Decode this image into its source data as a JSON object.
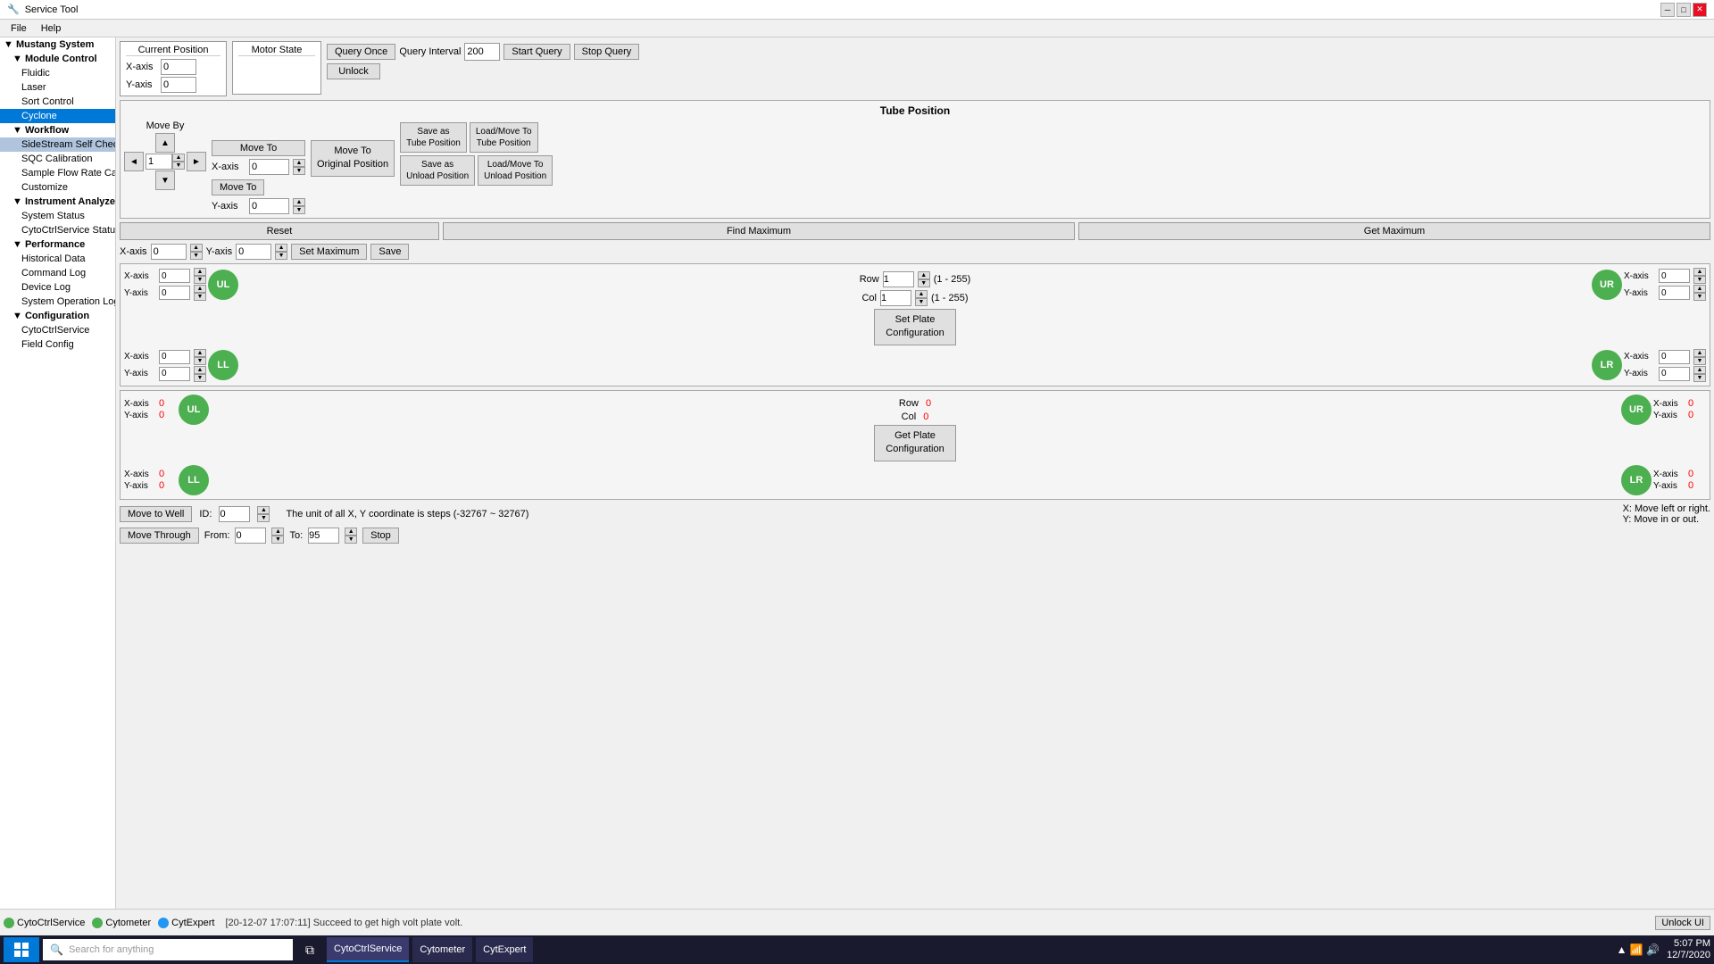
{
  "window": {
    "title": "Service Tool",
    "min_btn": "─",
    "max_btn": "□",
    "close_btn": "✕"
  },
  "menu": {
    "items": [
      "File",
      "Help"
    ]
  },
  "sidebar": {
    "items": [
      {
        "id": "mustang-system",
        "label": "Mustang System",
        "level": 0,
        "arrow": "▼"
      },
      {
        "id": "module-control",
        "label": "Module Control",
        "level": 1,
        "arrow": "▼"
      },
      {
        "id": "fluidic",
        "label": "Fluidic",
        "level": 2
      },
      {
        "id": "laser",
        "label": "Laser",
        "level": 2
      },
      {
        "id": "sort-control",
        "label": "Sort Control",
        "level": 2
      },
      {
        "id": "cyclone",
        "label": "Cyclone",
        "level": 2,
        "selected": true
      },
      {
        "id": "workflow",
        "label": "Workflow",
        "level": 1,
        "arrow": "▼"
      },
      {
        "id": "sidestream-self-check",
        "label": "SideStream Self Check",
        "level": 2,
        "highlighted": true
      },
      {
        "id": "sqc-calibration",
        "label": "SQC Calibration",
        "level": 2
      },
      {
        "id": "sample-flow-rate",
        "label": "Sample Flow Rate Calibration",
        "level": 2
      },
      {
        "id": "customize",
        "label": "Customize",
        "level": 2
      },
      {
        "id": "instrument-analyze",
        "label": "Instrument Analyze",
        "level": 1,
        "arrow": "▼"
      },
      {
        "id": "system-status",
        "label": "System Status",
        "level": 2
      },
      {
        "id": "cytoctrl-service-status",
        "label": "CytoCtrlService Status",
        "level": 2
      },
      {
        "id": "performance",
        "label": "Performance",
        "level": 1,
        "arrow": "▼"
      },
      {
        "id": "historical-data",
        "label": "Historical Data",
        "level": 2
      },
      {
        "id": "command-log",
        "label": "Command Log",
        "level": 2
      },
      {
        "id": "device-log",
        "label": "Device Log",
        "level": 2
      },
      {
        "id": "system-operation-log",
        "label": "System Operation Log",
        "level": 2
      },
      {
        "id": "configuration",
        "label": "Configuration",
        "level": 1,
        "arrow": "▼"
      },
      {
        "id": "cytoctrlservice",
        "label": "CytoCtrlService",
        "level": 2
      },
      {
        "id": "field-config",
        "label": "Field Config",
        "level": 2
      }
    ]
  },
  "content": {
    "query_once_label": "Query Once",
    "query_interval_label": "Query Interval",
    "query_interval_value": "200",
    "start_query_label": "Start Query",
    "stop_query_label": "Stop Query",
    "unlock_label": "Unlock",
    "current_position_title": "Current Position",
    "motor_state_title": "Motor State",
    "xaxis_label": "X-axis",
    "yaxis_label": "Y-axis",
    "xaxis_value": "0",
    "yaxis_value": "0",
    "move_by_label": "Move By",
    "move_to_label": "Move To",
    "move_to2_label": "Move To",
    "move_to_original_label": "Move To\nOriginal Position",
    "moveto_x_value": "0",
    "moveto_y_value": "0",
    "nav_value": "1",
    "save_tube_position_label": "Save as\nTube Position",
    "load_move_tube_label": "Load/Move To\nTube Position",
    "save_unload_label": "Save as\nUnload Position",
    "load_move_unload_label": "Load/Move To\nUnload Position",
    "reset_label": "Reset",
    "find_maximum_label": "Find Maximum",
    "get_maximum_label": "Get Maximum",
    "set_maximum_label": "Set Maximum",
    "save_label": "Save",
    "max_xaxis_label": "X-axis",
    "max_yaxis_label": "Y-axis",
    "max_xaxis_value": "0",
    "max_yaxis_value": "0",
    "ul_label": "UL",
    "ur_label": "UR",
    "ll_label": "LL",
    "lr_label": "LR",
    "ul1_x": "0",
    "ul1_y": "0",
    "ur1_x": "0",
    "ur1_y": "0",
    "ll1_x": "0",
    "ll1_y": "0",
    "lr1_x": "0",
    "lr1_y": "0",
    "row_label": "Row",
    "col_label": "Col",
    "row_value": "1",
    "col_value": "1",
    "row_range": "(1 - 255)",
    "col_range": "(1 - 255)",
    "set_plate_config_label": "Set Plate\nConfiguration",
    "ul2_label": "UL",
    "ur2_label": "UR",
    "ll2_label": "LL",
    "lr2_label": "LR",
    "ul2_x": "0",
    "ul2_y": "0",
    "ur2_x": "0",
    "ur2_y": "0",
    "ll2_x": "0",
    "ll2_y": "0",
    "lr2_x": "0",
    "lr2_y": "0",
    "row2_label": "Row",
    "col2_label": "Col",
    "row2_value": "0",
    "col2_value": "0",
    "get_plate_config_label": "Get Plate\nConfiguration",
    "move_to_well_label": "Move to Well",
    "id_label": "ID:",
    "id_value": "0",
    "unit_info": "The unit of all X, Y coordinate is steps (-32767 ~ 32767)",
    "move_info_x": "X: Move left or right.",
    "move_info_y": "Y: Move in or out.",
    "move_through_label": "Move Through",
    "from_label": "From:",
    "from_value": "0",
    "to_label": "To:",
    "to_value": "95",
    "stop_label": "Stop",
    "tube_position_title": "Tube Position"
  },
  "status_bar": {
    "cytoctrl_service_label": "CytoCtrlService",
    "cytometer_label": "Cytometer",
    "cytexpert_label": "CytExpert",
    "log_message": "[20-12-07 17:07:11] Succeed to get high volt plate volt.",
    "unlock_btn": "Unlock UI"
  },
  "taskbar": {
    "search_placeholder": "Search for anything",
    "time": "5:07 PM",
    "date": "12/7/2020",
    "app_labels": [
      "CytoCtrlService",
      "Cytometer",
      "CytExpert"
    ]
  }
}
